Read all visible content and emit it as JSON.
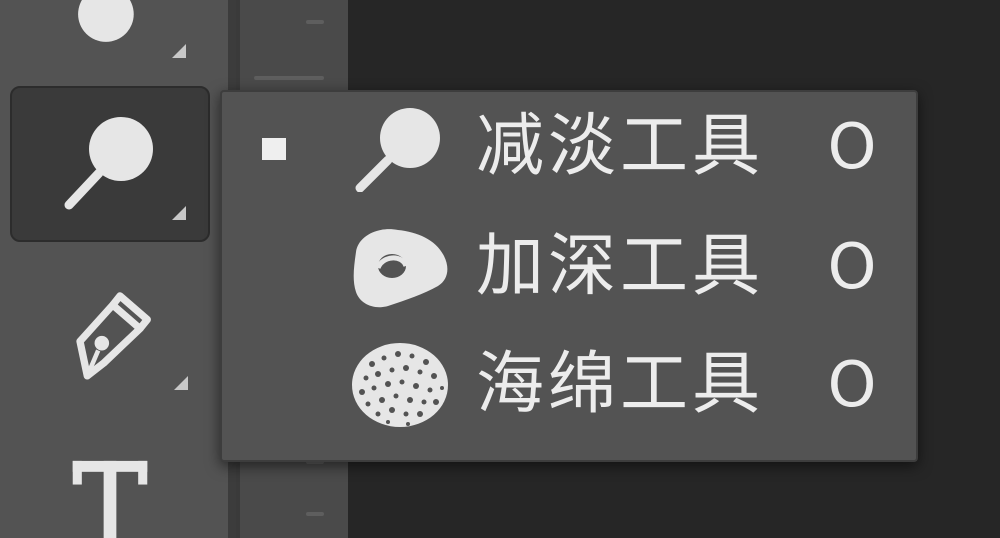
{
  "toolbar": {
    "tools": [
      {
        "name": "blur-tool-partial",
        "icon": "drop-icon",
        "active": false
      },
      {
        "name": "dodge-tool",
        "icon": "dodge-icon",
        "active": true
      },
      {
        "name": "pen-tool",
        "icon": "pen-icon",
        "active": false
      },
      {
        "name": "type-tool",
        "icon": "type-icon",
        "active": false
      }
    ]
  },
  "flyout": {
    "items": [
      {
        "label": "减淡工具",
        "shortcut": "O",
        "icon": "dodge-icon",
        "selected": true
      },
      {
        "label": "加深工具",
        "shortcut": "O",
        "icon": "burn-icon",
        "selected": false
      },
      {
        "label": "海绵工具",
        "shortcut": "O",
        "icon": "sponge-icon",
        "selected": false
      }
    ]
  },
  "colors": {
    "toolbar_bg": "#535353",
    "canvas_bg": "#262626",
    "menu_bg": "#535353",
    "text": "#ececec"
  }
}
